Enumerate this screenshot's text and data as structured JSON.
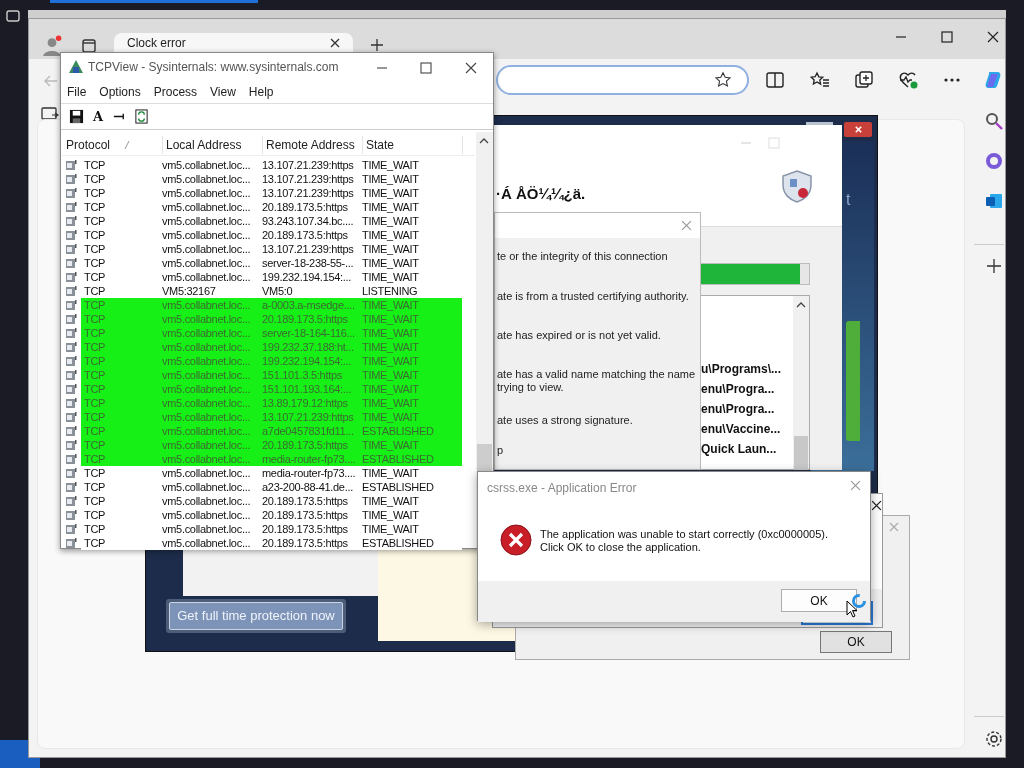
{
  "browser": {
    "tabs": [
      {
        "title": "Clock error",
        "selected": true
      }
    ]
  },
  "tcpview": {
    "title": "TCPView - Sysinternals: www.sysinternals.com",
    "menu": [
      "File",
      "Options",
      "Process",
      "View",
      "Help"
    ],
    "font_tool": "A",
    "columns": [
      "Protocol",
      "Local Address",
      "Remote Address",
      "State"
    ],
    "rows": [
      {
        "protocol": "TCP",
        "local": "vm5.collabnet.loc...",
        "remote": "13.107.21.239:https",
        "state": "TIME_WAIT",
        "selected": false
      },
      {
        "protocol": "TCP",
        "local": "vm5.collabnet.loc...",
        "remote": "13.107.21.239:https",
        "state": "TIME_WAIT",
        "selected": false
      },
      {
        "protocol": "TCP",
        "local": "vm5.collabnet.loc...",
        "remote": "13.107.21.239:https",
        "state": "TIME_WAIT",
        "selected": false
      },
      {
        "protocol": "TCP",
        "local": "vm5.collabnet.loc...",
        "remote": "20.189.173.5:https",
        "state": "TIME_WAIT",
        "selected": false
      },
      {
        "protocol": "TCP",
        "local": "vm5.collabnet.loc...",
        "remote": "93.243.107.34.bc....",
        "state": "TIME_WAIT",
        "selected": false
      },
      {
        "protocol": "TCP",
        "local": "vm5.collabnet.loc...",
        "remote": "20.189.173.5:https",
        "state": "TIME_WAIT",
        "selected": false
      },
      {
        "protocol": "TCP",
        "local": "vm5.collabnet.loc...",
        "remote": "13.107.21.239:https",
        "state": "TIME_WAIT",
        "selected": false
      },
      {
        "protocol": "TCP",
        "local": "vm5.collabnet.loc...",
        "remote": "server-18-238-55-...",
        "state": "TIME_WAIT",
        "selected": false
      },
      {
        "protocol": "TCP",
        "local": "vm5.collabnet.loc...",
        "remote": "199.232.194.154:...",
        "state": "TIME_WAIT",
        "selected": false
      },
      {
        "protocol": "TCP",
        "local": "VM5:32167",
        "remote": "VM5:0",
        "state": "LISTENING",
        "selected": false
      },
      {
        "protocol": "TCP",
        "local": "vm5.collabnet.loc...",
        "remote": "a-0003.a-msedge....",
        "state": "TIME_WAIT",
        "selected": true
      },
      {
        "protocol": "TCP",
        "local": "vm5.collabnet.loc...",
        "remote": "20.189.173.5:https",
        "state": "TIME_WAIT",
        "selected": true
      },
      {
        "protocol": "TCP",
        "local": "vm5.collabnet.loc...",
        "remote": "server-18-164-116...",
        "state": "TIME_WAIT",
        "selected": true
      },
      {
        "protocol": "TCP",
        "local": "vm5.collabnet.loc...",
        "remote": "199.232.37.188:ht...",
        "state": "TIME_WAIT",
        "selected": true
      },
      {
        "protocol": "TCP",
        "local": "vm5.collabnet.loc...",
        "remote": "199.232.194.154:...",
        "state": "TIME_WAIT",
        "selected": true
      },
      {
        "protocol": "TCP",
        "local": "vm5.collabnet.loc...",
        "remote": "151.101.3.5:https",
        "state": "TIME_WAIT",
        "selected": true
      },
      {
        "protocol": "TCP",
        "local": "vm5.collabnet.loc...",
        "remote": "151.101.193.164:...",
        "state": "TIME_WAIT",
        "selected": true
      },
      {
        "protocol": "TCP",
        "local": "vm5.collabnet.loc...",
        "remote": "13.89.179.12:https",
        "state": "TIME_WAIT",
        "selected": true
      },
      {
        "protocol": "TCP",
        "local": "vm5.collabnet.loc...",
        "remote": "13.107.21.239:https",
        "state": "TIME_WAIT",
        "selected": true
      },
      {
        "protocol": "TCP",
        "local": "vm5.collabnet.loc...",
        "remote": "a7de0457831fd11...",
        "state": "ESTABLISHED",
        "selected": true
      },
      {
        "protocol": "TCP",
        "local": "vm5.collabnet.loc...",
        "remote": "20.189.173.5:https",
        "state": "TIME_WAIT",
        "selected": true
      },
      {
        "protocol": "TCP",
        "local": "vm5.collabnet.loc...",
        "remote": "media-router-fp73....",
        "state": "ESTABLISHED",
        "selected": true
      },
      {
        "protocol": "TCP",
        "local": "vm5.collabnet.loc...",
        "remote": "media-router-fp73....",
        "state": "TIME_WAIT",
        "selected": false
      },
      {
        "protocol": "TCP",
        "local": "vm5.collabnet.loc...",
        "remote": "a23-200-88-41.de...",
        "state": "ESTABLISHED",
        "selected": false
      },
      {
        "protocol": "TCP",
        "local": "vm5.collabnet.loc...",
        "remote": "20.189.173.5:https",
        "state": "TIME_WAIT",
        "selected": false
      },
      {
        "protocol": "TCP",
        "local": "vm5.collabnet.loc...",
        "remote": "20.189.173.5:https",
        "state": "TIME_WAIT",
        "selected": false
      },
      {
        "protocol": "TCP",
        "local": "vm5.collabnet.loc...",
        "remote": "20.189.173.5:https",
        "state": "TIME_WAIT",
        "selected": false
      },
      {
        "protocol": "TCP",
        "local": "vm5.collabnet.loc...",
        "remote": "20.189.173.5:https",
        "state": "ESTABLISHED",
        "selected": false
      }
    ]
  },
  "antivirus": {
    "heading": "·Á ÅÖ¼¼¿ä.",
    "side_fragment": "t",
    "progress": {
      "level": 0.92
    },
    "files": [
      "u\\Programs\\...",
      "enu\\Progra...",
      "enu\\Progra...",
      "enu\\Vaccine...",
      "Quick Laun..."
    ],
    "promo_button": "Get full time protection now"
  },
  "certificate_dialog": {
    "items": [
      {
        "lines": [
          "te or the integrity of this connection"
        ]
      },
      {
        "lines": [
          "ate is from a trusted certifying authority."
        ]
      },
      {
        "lines": [
          "ate has expired or is not yet valid."
        ]
      },
      {
        "lines": [
          "ate has a valid name matching the name",
          "trying to view."
        ]
      },
      {
        "lines": [
          "ate uses a strong signature."
        ]
      },
      {
        "lines": [
          "p"
        ]
      }
    ]
  },
  "background_dialog": {
    "button": "OK"
  },
  "error_dialog": {
    "title": "csrss.exe - Application Error",
    "message": [
      "The application was unable to start correctly (0xc0000005).",
      "Click OK to close the application."
    ],
    "button": "OK"
  }
}
